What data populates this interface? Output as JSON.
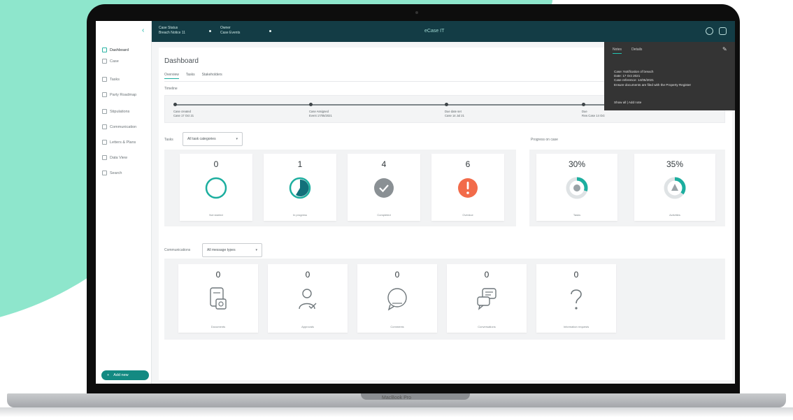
{
  "device": {
    "model_label": "MacBook Pro"
  },
  "topbar": {
    "group1": {
      "line1": "Case Status",
      "line2": "Breach Notice 11"
    },
    "group2": {
      "line1": "Owner",
      "line2": "Case Events"
    },
    "app_title": "eCase IT"
  },
  "sidebar": {
    "items": [
      {
        "label": "Dashboard"
      },
      {
        "label": "Case"
      },
      {
        "label": "Tasks"
      },
      {
        "label": "Party Roadmap"
      },
      {
        "label": "Stipulations"
      },
      {
        "label": "Communication"
      },
      {
        "label": "Letters & Plans"
      },
      {
        "label": "Data View"
      },
      {
        "label": "Search"
      }
    ],
    "bottom_button": "Add new"
  },
  "page": {
    "title": "Dashboard",
    "tabs": [
      "Overview",
      "Tasks",
      "Stakeholders"
    ],
    "timeline_label": "Timeline",
    "timeline": [
      {
        "title": "Case created",
        "date": "Case 17 Oct 21"
      },
      {
        "title": "Case Assigned",
        "date": "Event 17/05/2021"
      },
      {
        "title": "Due date set",
        "date": "Case 14 Jul 21"
      },
      {
        "title": "Due",
        "date": "Rvw Case 14 Oct"
      }
    ]
  },
  "tasks": {
    "label": "Tasks",
    "filter_value": "All task categories",
    "cards": [
      {
        "value": "0",
        "label": "Not started"
      },
      {
        "value": "1",
        "label": "In progress"
      },
      {
        "value": "4",
        "label": "Completed"
      },
      {
        "value": "6",
        "label": "Overdue"
      }
    ]
  },
  "progress": {
    "label": "Progress on case",
    "cards": [
      {
        "value": "30%",
        "fraction": 0.3,
        "label": "Tasks"
      },
      {
        "value": "35%",
        "fraction": 0.35,
        "label": "Activities"
      }
    ]
  },
  "communications": {
    "label": "Communications",
    "filter_value": "All message types",
    "cards": [
      {
        "value": "0",
        "label": "Documents",
        "icon": "document-icon"
      },
      {
        "value": "0",
        "label": "Approvals",
        "icon": "person-check-icon"
      },
      {
        "value": "0",
        "label": "Comments",
        "icon": "chat-bubble-icon"
      },
      {
        "value": "0",
        "label": "Conversations",
        "icon": "conversation-icon"
      },
      {
        "value": "0",
        "label": "Information requests",
        "icon": "question-icon"
      }
    ]
  },
  "overlay": {
    "tabs": [
      "Notes",
      "Details"
    ],
    "lines": [
      "Case: Notification of breach",
      "Date: 17 Oct 2021",
      "Case reference: 14/05/2021",
      "Ensure documents are filed with the Property Register"
    ],
    "footer": "Show all  |  Add note"
  },
  "colors": {
    "accent": "#1cae9f",
    "topbar": "#133c45",
    "overdue": "#f26b4a",
    "completed": "#8a9094",
    "background_blob": "#8ee6cc"
  }
}
